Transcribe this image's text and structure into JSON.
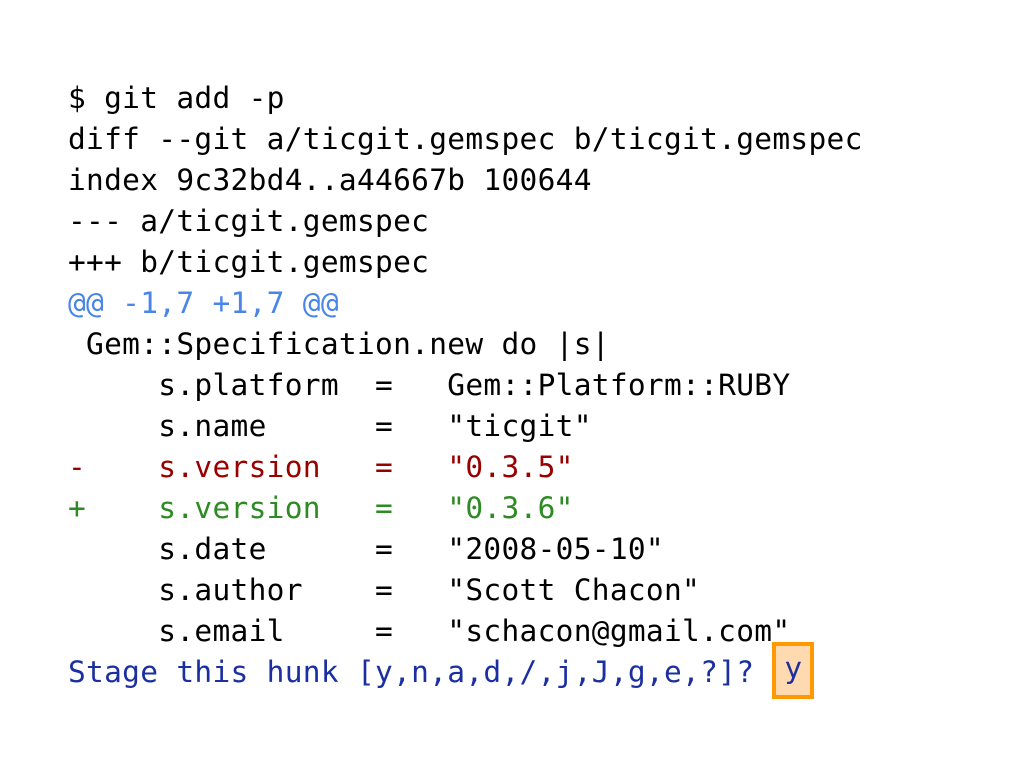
{
  "terminal": {
    "lines": [
      {
        "kind": "command",
        "text": "$ git add -p"
      },
      {
        "kind": "meta",
        "text": "diff --git a/ticgit.gemspec b/ticgit.gemspec"
      },
      {
        "kind": "meta",
        "text": "index 9c32bd4..a44667b 100644"
      },
      {
        "kind": "meta",
        "text": "--- a/ticgit.gemspec"
      },
      {
        "kind": "meta",
        "text": "+++ b/ticgit.gemspec"
      },
      {
        "kind": "hunk",
        "text": "@@ -1,7 +1,7 @@"
      },
      {
        "kind": "context",
        "text": " Gem::Specification.new do |s|"
      },
      {
        "kind": "context",
        "text": "     s.platform  =   Gem::Platform::RUBY"
      },
      {
        "kind": "context",
        "text": "     s.name      =   \"ticgit\""
      },
      {
        "kind": "removed",
        "text": "-    s.version   =   \"0.3.5\""
      },
      {
        "kind": "added",
        "text": "+    s.version   =   \"0.3.6\""
      },
      {
        "kind": "context",
        "text": "     s.date      =   \"2008-05-10\""
      },
      {
        "kind": "context",
        "text": "     s.author    =   \"Scott Chacon\""
      },
      {
        "kind": "context",
        "text": "     s.email     =   \"schacon@gmail.com\""
      }
    ],
    "prompt": {
      "text": "Stage this hunk [y,n,a,d,/,j,J,g,e,?]?",
      "answer": "y"
    }
  },
  "colors": {
    "hunk": "#4a86e8",
    "removed": "#990000",
    "added": "#2e8b24",
    "prompt": "#1b2fa0",
    "highlight_border": "#ff9900",
    "highlight_fill": "#ffd9b0"
  }
}
